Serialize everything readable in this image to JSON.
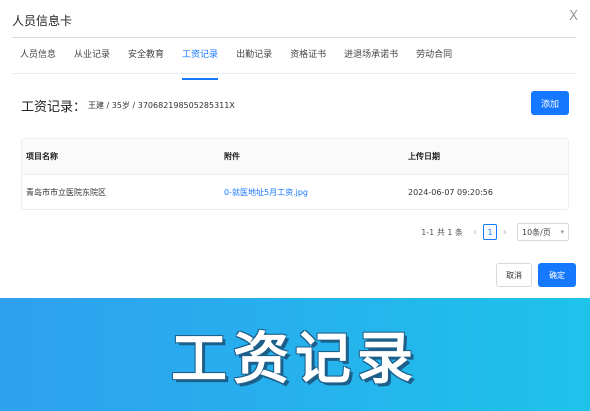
{
  "dialog": {
    "title": "人员信息卡",
    "close_label": "X"
  },
  "tabs": [
    {
      "label": "人员信息",
      "active": false
    },
    {
      "label": "从业记录",
      "active": false
    },
    {
      "label": "安全教育",
      "active": false
    },
    {
      "label": "工资记录",
      "active": true
    },
    {
      "label": "出勤记录",
      "active": false
    },
    {
      "label": "资格证书",
      "active": false
    },
    {
      "label": "进退场承诺书",
      "active": false
    },
    {
      "label": "劳动合同",
      "active": false
    }
  ],
  "section": {
    "title": "工资记录：",
    "person_info": "王建 / 35岁 / 370682198505285311X",
    "add_label": "添加"
  },
  "table": {
    "headers": [
      "项目名称",
      "附件",
      "上传日期"
    ],
    "rows": [
      {
        "project": "青岛市市立医院东院区",
        "attachment": "0-就医地址5月工资.jpg",
        "date": "2024-06-07 09:20:56"
      }
    ]
  },
  "pagination": {
    "total_text": "1-1 共 1 条",
    "current_page": "1",
    "page_size": "10条/页",
    "prev_icon": "‹",
    "next_icon": "›"
  },
  "footer": {
    "cancel_label": "取消",
    "ok_label": "确定"
  },
  "banner": {
    "text": "工资记录"
  },
  "colors": {
    "primary": "#1677ff",
    "banner_start": "#2f9ff0",
    "banner_end": "#1ec3ea"
  }
}
